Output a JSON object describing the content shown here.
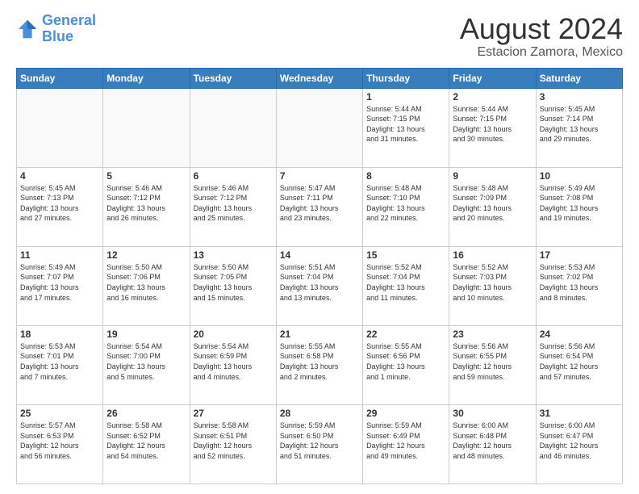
{
  "header": {
    "logo_line1": "General",
    "logo_line2": "Blue",
    "main_title": "August 2024",
    "subtitle": "Estacion Zamora, Mexico"
  },
  "days_of_week": [
    "Sunday",
    "Monday",
    "Tuesday",
    "Wednesday",
    "Thursday",
    "Friday",
    "Saturday"
  ],
  "weeks": [
    [
      {
        "day": "",
        "info": ""
      },
      {
        "day": "",
        "info": ""
      },
      {
        "day": "",
        "info": ""
      },
      {
        "day": "",
        "info": ""
      },
      {
        "day": "1",
        "info": "Sunrise: 5:44 AM\nSunset: 7:15 PM\nDaylight: 13 hours\nand 31 minutes."
      },
      {
        "day": "2",
        "info": "Sunrise: 5:44 AM\nSunset: 7:15 PM\nDaylight: 13 hours\nand 30 minutes."
      },
      {
        "day": "3",
        "info": "Sunrise: 5:45 AM\nSunset: 7:14 PM\nDaylight: 13 hours\nand 29 minutes."
      }
    ],
    [
      {
        "day": "4",
        "info": "Sunrise: 5:45 AM\nSunset: 7:13 PM\nDaylight: 13 hours\nand 27 minutes."
      },
      {
        "day": "5",
        "info": "Sunrise: 5:46 AM\nSunset: 7:12 PM\nDaylight: 13 hours\nand 26 minutes."
      },
      {
        "day": "6",
        "info": "Sunrise: 5:46 AM\nSunset: 7:12 PM\nDaylight: 13 hours\nand 25 minutes."
      },
      {
        "day": "7",
        "info": "Sunrise: 5:47 AM\nSunset: 7:11 PM\nDaylight: 13 hours\nand 23 minutes."
      },
      {
        "day": "8",
        "info": "Sunrise: 5:48 AM\nSunset: 7:10 PM\nDaylight: 13 hours\nand 22 minutes."
      },
      {
        "day": "9",
        "info": "Sunrise: 5:48 AM\nSunset: 7:09 PM\nDaylight: 13 hours\nand 20 minutes."
      },
      {
        "day": "10",
        "info": "Sunrise: 5:49 AM\nSunset: 7:08 PM\nDaylight: 13 hours\nand 19 minutes."
      }
    ],
    [
      {
        "day": "11",
        "info": "Sunrise: 5:49 AM\nSunset: 7:07 PM\nDaylight: 13 hours\nand 17 minutes."
      },
      {
        "day": "12",
        "info": "Sunrise: 5:50 AM\nSunset: 7:06 PM\nDaylight: 13 hours\nand 16 minutes."
      },
      {
        "day": "13",
        "info": "Sunrise: 5:50 AM\nSunset: 7:05 PM\nDaylight: 13 hours\nand 15 minutes."
      },
      {
        "day": "14",
        "info": "Sunrise: 5:51 AM\nSunset: 7:04 PM\nDaylight: 13 hours\nand 13 minutes."
      },
      {
        "day": "15",
        "info": "Sunrise: 5:52 AM\nSunset: 7:04 PM\nDaylight: 13 hours\nand 11 minutes."
      },
      {
        "day": "16",
        "info": "Sunrise: 5:52 AM\nSunset: 7:03 PM\nDaylight: 13 hours\nand 10 minutes."
      },
      {
        "day": "17",
        "info": "Sunrise: 5:53 AM\nSunset: 7:02 PM\nDaylight: 13 hours\nand 8 minutes."
      }
    ],
    [
      {
        "day": "18",
        "info": "Sunrise: 5:53 AM\nSunset: 7:01 PM\nDaylight: 13 hours\nand 7 minutes."
      },
      {
        "day": "19",
        "info": "Sunrise: 5:54 AM\nSunset: 7:00 PM\nDaylight: 13 hours\nand 5 minutes."
      },
      {
        "day": "20",
        "info": "Sunrise: 5:54 AM\nSunset: 6:59 PM\nDaylight: 13 hours\nand 4 minutes."
      },
      {
        "day": "21",
        "info": "Sunrise: 5:55 AM\nSunset: 6:58 PM\nDaylight: 13 hours\nand 2 minutes."
      },
      {
        "day": "22",
        "info": "Sunrise: 5:55 AM\nSunset: 6:56 PM\nDaylight: 13 hours\nand 1 minute."
      },
      {
        "day": "23",
        "info": "Sunrise: 5:56 AM\nSunset: 6:55 PM\nDaylight: 12 hours\nand 59 minutes."
      },
      {
        "day": "24",
        "info": "Sunrise: 5:56 AM\nSunset: 6:54 PM\nDaylight: 12 hours\nand 57 minutes."
      }
    ],
    [
      {
        "day": "25",
        "info": "Sunrise: 5:57 AM\nSunset: 6:53 PM\nDaylight: 12 hours\nand 56 minutes."
      },
      {
        "day": "26",
        "info": "Sunrise: 5:58 AM\nSunset: 6:52 PM\nDaylight: 12 hours\nand 54 minutes."
      },
      {
        "day": "27",
        "info": "Sunrise: 5:58 AM\nSunset: 6:51 PM\nDaylight: 12 hours\nand 52 minutes."
      },
      {
        "day": "28",
        "info": "Sunrise: 5:59 AM\nSunset: 6:50 PM\nDaylight: 12 hours\nand 51 minutes."
      },
      {
        "day": "29",
        "info": "Sunrise: 5:59 AM\nSunset: 6:49 PM\nDaylight: 12 hours\nand 49 minutes."
      },
      {
        "day": "30",
        "info": "Sunrise: 6:00 AM\nSunset: 6:48 PM\nDaylight: 12 hours\nand 48 minutes."
      },
      {
        "day": "31",
        "info": "Sunrise: 6:00 AM\nSunset: 6:47 PM\nDaylight: 12 hours\nand 46 minutes."
      }
    ]
  ]
}
